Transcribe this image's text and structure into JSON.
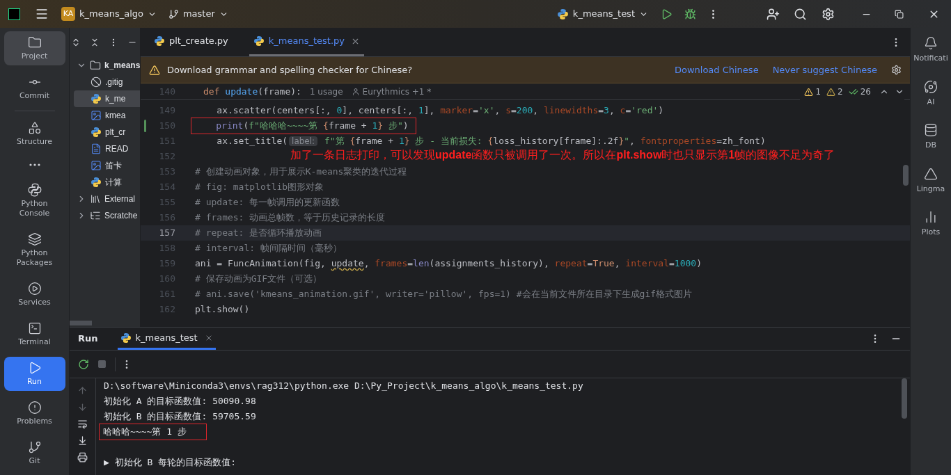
{
  "title_bar": {
    "project_badge": "KA",
    "project": "k_means_algo",
    "branch": "master",
    "run_config": "k_means_test"
  },
  "left_tools": [
    {
      "kind": "folder",
      "label": "Project",
      "selected": true,
      "focused": false
    },
    {
      "kind": "commit",
      "label": "Commit",
      "selected": false,
      "focused": false
    },
    {
      "kind": "structure",
      "label": "Structure",
      "selected": false,
      "focused": false
    },
    {
      "kind": "more",
      "selected": false,
      "focused": false
    },
    {
      "kind": "python",
      "label": "Python Console",
      "selected": false,
      "focused": false
    },
    {
      "kind": "layers",
      "label": "Python Packages",
      "selected": false,
      "focused": false
    },
    {
      "kind": "services",
      "label": "Services",
      "selected": false,
      "focused": false
    },
    {
      "kind": "terminal",
      "label": "Terminal",
      "selected": false,
      "focused": false
    },
    {
      "kind": "run",
      "label": "Run",
      "selected": true,
      "focused": true
    },
    {
      "kind": "problems",
      "label": "Problems",
      "selected": false,
      "focused": false
    },
    {
      "kind": "git",
      "label": "Git",
      "selected": false,
      "focused": false
    }
  ],
  "project_tree": [
    {
      "kind": "folder",
      "label": "k_means",
      "expanded": true,
      "selected": false,
      "children": [
        {
          "kind": "ignore",
          "label": ".gitig",
          "selected": false
        },
        {
          "kind": "python",
          "label": "k_me",
          "selected": true
        },
        {
          "kind": "image",
          "label": "kmea",
          "selected": false
        },
        {
          "kind": "python",
          "label": "plt_cr",
          "selected": false
        },
        {
          "kind": "markdown",
          "label": "READ",
          "selected": false
        },
        {
          "kind": "image",
          "label": "笛卡",
          "selected": false
        },
        {
          "kind": "python",
          "label": "计算",
          "selected": false
        }
      ]
    },
    {
      "kind": "library",
      "label": "External",
      "expanded": false,
      "selected": false
    },
    {
      "kind": "scratches",
      "label": "Scratche",
      "expanded": false,
      "selected": false
    }
  ],
  "editor_tabs": [
    {
      "label": "plt_create.py",
      "selected": false
    },
    {
      "label": "k_means_test.py",
      "selected": true
    }
  ],
  "banner": {
    "message": "Download grammar and spelling checker for Chinese?",
    "actions": [
      "Download Chinese",
      "Never suggest Chinese"
    ]
  },
  "inspections": [
    {
      "kind": "warning",
      "count": "1"
    },
    {
      "kind": "weak",
      "count": "2"
    },
    {
      "kind": "typo",
      "count": "26"
    }
  ],
  "sticky_line": {
    "number": "140",
    "tokens": [
      {
        "kind": "kw",
        "text": "def "
      },
      {
        "kind": "fn",
        "text": "update"
      },
      {
        "kind": "plain",
        "text": "(frame):"
      }
    ],
    "usages": "1 usage",
    "author": "Eurythmics +1 *"
  },
  "code_lines": [
    {
      "number": "149",
      "current": false,
      "changed": false,
      "boxed": false,
      "tokens": [
        {
          "kind": "plain",
          "text": "    ax.scatter(centers[:, "
        },
        {
          "kind": "num",
          "text": "0"
        },
        {
          "kind": "plain",
          "text": "], centers[:, "
        },
        {
          "kind": "num",
          "text": "1"
        },
        {
          "kind": "plain",
          "text": "], "
        },
        {
          "kind": "param",
          "text": "marker"
        },
        {
          "kind": "plain",
          "text": "="
        },
        {
          "kind": "str",
          "text": "'x'"
        },
        {
          "kind": "plain",
          "text": ", "
        },
        {
          "kind": "param",
          "text": "s"
        },
        {
          "kind": "plain",
          "text": "="
        },
        {
          "kind": "num",
          "text": "200"
        },
        {
          "kind": "plain",
          "text": ", "
        },
        {
          "kind": "param",
          "text": "linewidths"
        },
        {
          "kind": "plain",
          "text": "="
        },
        {
          "kind": "num",
          "text": "3"
        },
        {
          "kind": "plain",
          "text": ", "
        },
        {
          "kind": "param",
          "text": "c"
        },
        {
          "kind": "plain",
          "text": "="
        },
        {
          "kind": "str",
          "text": "'red'"
        },
        {
          "kind": "plain",
          "text": ")"
        }
      ]
    },
    {
      "number": "150",
      "current": false,
      "changed": true,
      "boxed": true,
      "tokens": [
        {
          "kind": "builtin",
          "text": "    print"
        },
        {
          "kind": "plain",
          "text": "("
        },
        {
          "kind": "str",
          "text": "f\"哈哈哈~~~~第 "
        },
        {
          "kind": "brace",
          "text": "{"
        },
        {
          "kind": "plain",
          "text": "frame + "
        },
        {
          "kind": "num",
          "text": "1"
        },
        {
          "kind": "brace",
          "text": "}"
        },
        {
          "kind": "str",
          "text": " 步\""
        },
        {
          "kind": "plain",
          "text": ")"
        }
      ]
    },
    {
      "number": "151",
      "current": false,
      "changed": false,
      "boxed": false,
      "tokens": [
        {
          "kind": "plain",
          "text": "    ax.set_title("
        },
        {
          "kind": "hint",
          "text": "label:"
        },
        {
          "kind": "str",
          "text": " f\"第 "
        },
        {
          "kind": "brace",
          "text": "{"
        },
        {
          "kind": "plain",
          "text": "frame + "
        },
        {
          "kind": "num",
          "text": "1"
        },
        {
          "kind": "brace",
          "text": "}"
        },
        {
          "kind": "str",
          "text": " 步 - 当前损失: "
        },
        {
          "kind": "brace",
          "text": "{"
        },
        {
          "kind": "plain",
          "text": "loss_history[frame]:.2f"
        },
        {
          "kind": "brace",
          "text": "}"
        },
        {
          "kind": "str",
          "text": "\""
        },
        {
          "kind": "plain",
          "text": ", "
        },
        {
          "kind": "param",
          "text": "fontproperties"
        },
        {
          "kind": "plain",
          "text": "=zh_font)"
        }
      ]
    },
    {
      "number": "152",
      "current": false,
      "changed": false,
      "boxed": false,
      "annotation": "加了一条日志打印，可以发现**update**函数只被调用了一次。所以在**plt.show**时也只显示第**1**帧的图像不足为奇了"
    },
    {
      "number": "153",
      "current": false,
      "changed": false,
      "boxed": false,
      "tokens": [
        {
          "kind": "comment",
          "text": "# 创建动画对象，用于展示K-means聚类的迭代过程"
        }
      ]
    },
    {
      "number": "154",
      "current": false,
      "changed": false,
      "boxed": false,
      "tokens": [
        {
          "kind": "comment",
          "text": "# fig: matplotlib图形对象"
        }
      ]
    },
    {
      "number": "155",
      "current": false,
      "changed": false,
      "boxed": false,
      "tokens": [
        {
          "kind": "comment",
          "text": "# update: 每一帧调用的更新函数"
        }
      ]
    },
    {
      "number": "156",
      "current": false,
      "changed": false,
      "boxed": false,
      "tokens": [
        {
          "kind": "comment",
          "text": "# frames: 动画总帧数，等于历史记录的长度"
        }
      ]
    },
    {
      "number": "157",
      "current": true,
      "changed": false,
      "boxed": false,
      "tokens": [
        {
          "kind": "comment",
          "text": "# repeat: 是否循环播放动画"
        }
      ]
    },
    {
      "number": "158",
      "current": false,
      "changed": false,
      "boxed": false,
      "tokens": [
        {
          "kind": "comment",
          "text": "# interval: 帧间隔时间（毫秒）"
        }
      ]
    },
    {
      "number": "159",
      "current": false,
      "changed": false,
      "boxed": false,
      "tokens": [
        {
          "kind": "plain",
          "text": "ani = FuncAnimation(fig, "
        },
        {
          "kind": "squiggle",
          "text": "update"
        },
        {
          "kind": "plain",
          "text": ", "
        },
        {
          "kind": "param",
          "text": "frames"
        },
        {
          "kind": "plain",
          "text": "="
        },
        {
          "kind": "builtin",
          "text": "len"
        },
        {
          "kind": "plain",
          "text": "(assignments_history), "
        },
        {
          "kind": "param",
          "text": "repeat"
        },
        {
          "kind": "plain",
          "text": "="
        },
        {
          "kind": "kw",
          "text": "True"
        },
        {
          "kind": "plain",
          "text": ", "
        },
        {
          "kind": "param",
          "text": "interval"
        },
        {
          "kind": "plain",
          "text": "="
        },
        {
          "kind": "num",
          "text": "1000"
        },
        {
          "kind": "plain",
          "text": ")"
        }
      ]
    },
    {
      "number": "160",
      "current": false,
      "changed": false,
      "boxed": false,
      "tokens": [
        {
          "kind": "comment",
          "text": "# 保存动画为GIF文件（可选）"
        }
      ]
    },
    {
      "number": "161",
      "current": false,
      "changed": false,
      "boxed": false,
      "tokens": [
        {
          "kind": "comment",
          "text": "# ani.save('kmeans_animation.gif', writer='pillow', fps=1) #会在当前文件所在目录下生成gif格式图片"
        }
      ]
    },
    {
      "number": "162",
      "current": false,
      "changed": false,
      "boxed": false,
      "tokens": [
        {
          "kind": "plain",
          "text": "plt.show()"
        }
      ]
    }
  ],
  "run_panel": {
    "title": "Run",
    "tabs": [
      {
        "label": "k_means_test",
        "selected": true
      }
    ],
    "output": [
      {
        "kind": "line",
        "text": "D:\\software\\Miniconda3\\envs\\rag312\\python.exe D:\\Py_Project\\k_means_algo\\k_means_test.py",
        "boxed": false
      },
      {
        "kind": "line",
        "text": "初始化 A 的目标函数值: 50090.98",
        "boxed": false
      },
      {
        "kind": "line",
        "text": "初始化 B 的目标函数值: 59705.59",
        "boxed": false
      },
      {
        "kind": "line",
        "text": "哈哈哈~~~~第 1 步",
        "boxed": true
      },
      {
        "kind": "blank",
        "boxed": false
      },
      {
        "kind": "line",
        "text": "▶ 初始化 B 每轮的目标函数值:",
        "boxed": false
      }
    ]
  },
  "right_tools": [
    {
      "kind": "bell",
      "label": "Notificati"
    },
    {
      "kind": "swirl",
      "label": "AI"
    },
    {
      "kind": "database",
      "label": "DB"
    },
    {
      "kind": "triangle",
      "label": "Lingma"
    },
    {
      "kind": "chart",
      "label": "Plots"
    }
  ]
}
